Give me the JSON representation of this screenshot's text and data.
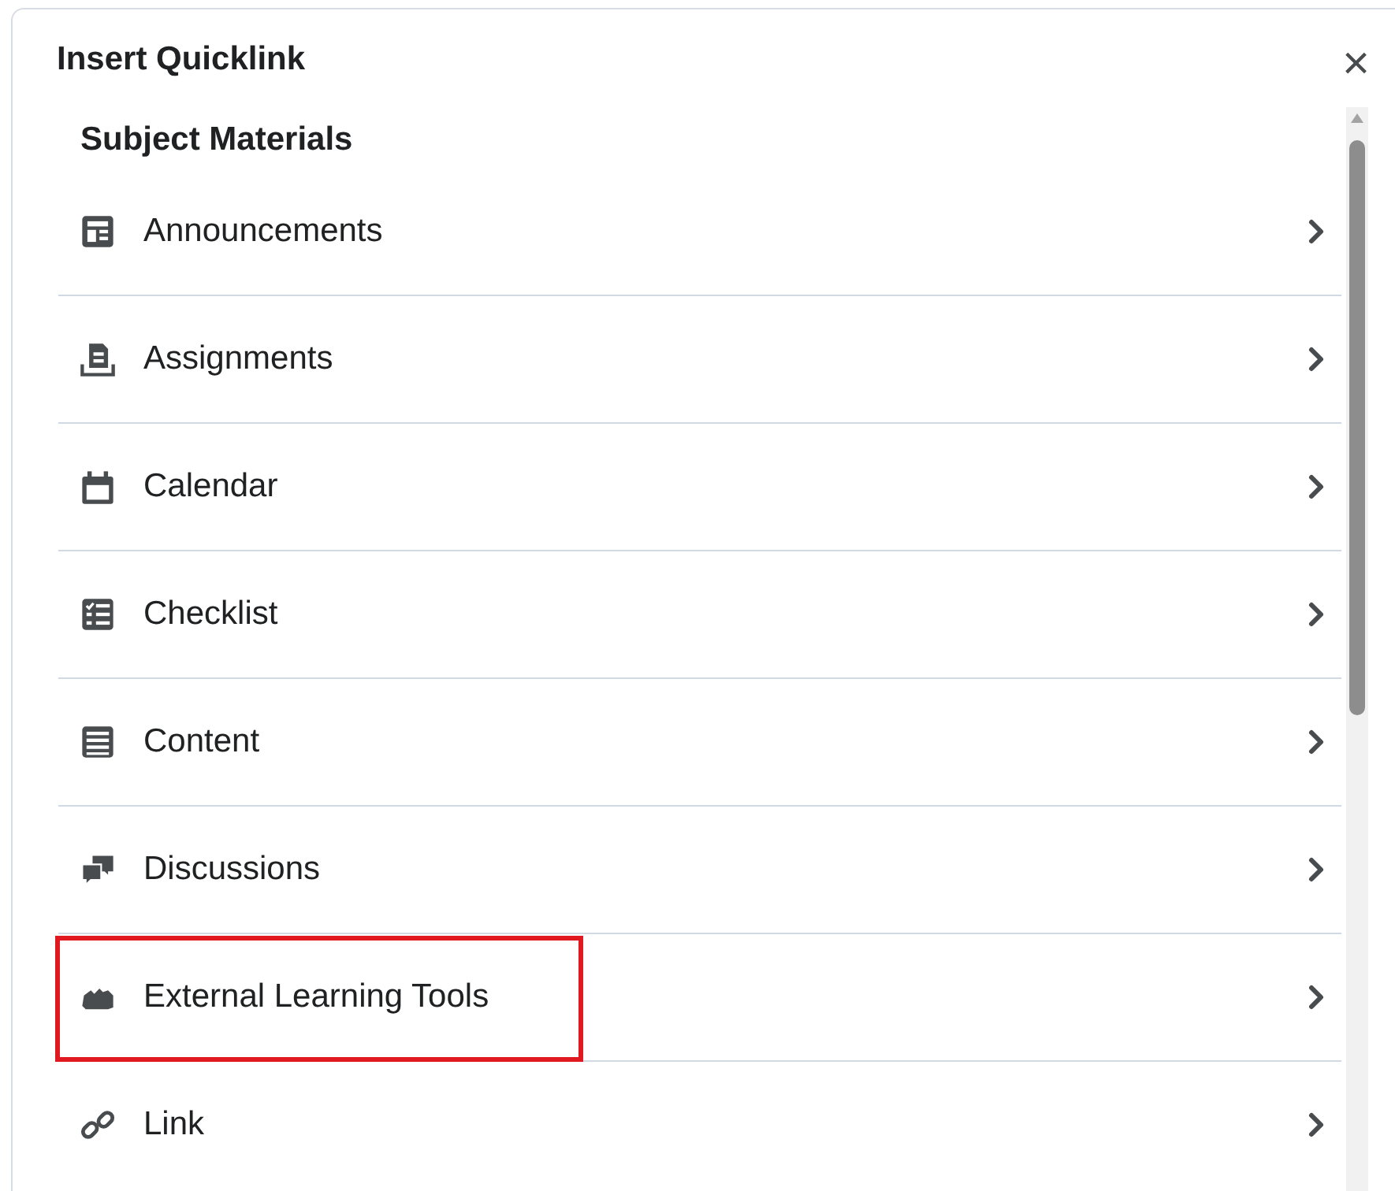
{
  "dialog": {
    "title": "Insert Quicklink",
    "close": "×"
  },
  "section": {
    "title": "Subject Materials"
  },
  "items": [
    {
      "label": "Announcements",
      "highlighted": false
    },
    {
      "label": "Assignments",
      "highlighted": false
    },
    {
      "label": "Calendar",
      "highlighted": false
    },
    {
      "label": "Checklist",
      "highlighted": false
    },
    {
      "label": "Content",
      "highlighted": false
    },
    {
      "label": "Discussions",
      "highlighted": false
    },
    {
      "label": "External Learning Tools",
      "highlighted": true
    },
    {
      "label": "Link",
      "highlighted": false
    }
  ]
}
